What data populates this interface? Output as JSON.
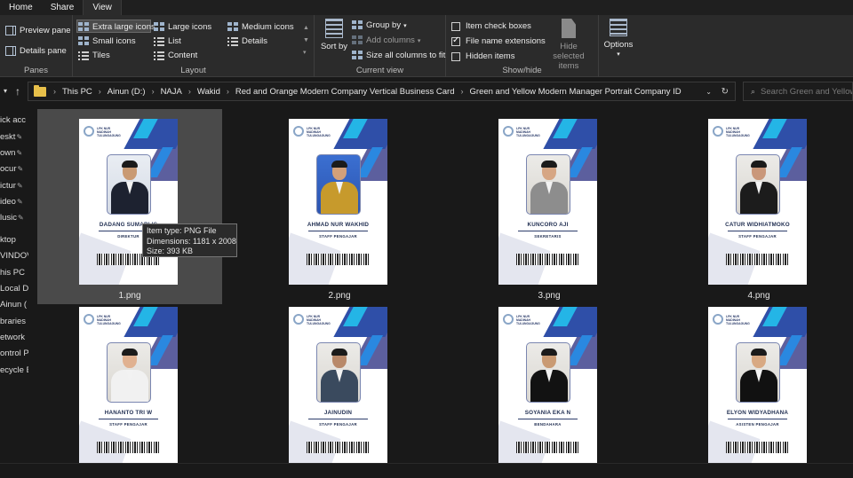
{
  "menu": {
    "tabs": [
      "Home",
      "Share",
      "View"
    ],
    "active": "View"
  },
  "ribbon": {
    "panes": {
      "preview": "Preview pane",
      "details": "Details pane",
      "label": "Panes"
    },
    "layout": {
      "items": [
        "Extra large icons",
        "Large icons",
        "Medium icons",
        "Small icons",
        "List",
        "Details",
        "Tiles",
        "Content"
      ],
      "selected": "Extra large icons",
      "label": "Layout"
    },
    "current_view": {
      "sort": "Sort by",
      "group": "Group by",
      "add_columns": "Add columns",
      "size_all": "Size all columns to fit",
      "label": "Current view"
    },
    "show_hide": {
      "item_check_boxes": "Item check boxes",
      "file_name_extensions": "File name extensions",
      "hidden_items": "Hidden items",
      "file_name_extensions_checked": true,
      "hide_selected": "Hide selected items",
      "label": "Show/hide"
    },
    "options": "Options"
  },
  "address": {
    "crumbs": [
      "This PC",
      "Ainun (D:)",
      "NAJA",
      "Wakid",
      "Red and Orange Modern Company Vertical Business Card",
      "Green and Yellow Modern Manager Portrait Company ID"
    ],
    "search_placeholder": "Search Green and Yellow Modern Manager Portrait Company ID"
  },
  "navpane": {
    "items": [
      "ick acc",
      "eskt",
      "own",
      "ocur",
      "ictur",
      "ideo",
      "lusic",
      "ktop",
      "VINDOV",
      "his PC",
      "Local D",
      "Ainun (",
      "braries",
      "etwork",
      "ontrol P",
      "ecycle E"
    ]
  },
  "files": [
    {
      "filename": "1.png",
      "name": "DADANG SUMARLIS",
      "role": "DIREKTUR"
    },
    {
      "filename": "2.png",
      "name": "AHMAD NUR WAKHID",
      "role": "STAFF PENGAJAR"
    },
    {
      "filename": "3.png",
      "name": "KUNCORO AJI",
      "role": "SEKRETARIS"
    },
    {
      "filename": "4.png",
      "name": "CATUR WIDHIATMOKO",
      "role": "STAFF PENGAJAR"
    },
    {
      "filename": "",
      "name": "HANANTO TRI W",
      "role": "STAFF PENGAJAR"
    },
    {
      "filename": "",
      "name": "JAINUDIN",
      "role": "STAFF PENGAJAR"
    },
    {
      "filename": "",
      "name": "SOYANIA EKA N",
      "role": "BENDAHARA"
    },
    {
      "filename": "",
      "name": "ELYON WIDYADHANA",
      "role": "ASISTEN PENGAJAR"
    }
  ],
  "card_logo_text": "LPK NUR MADINAH TULUNGAGUNG",
  "tooltip": {
    "type": "Item type: PNG File",
    "dimensions": "Dimensions: 1181 x 2008",
    "size": "Size: 393 KB"
  },
  "colors": {
    "card_blue": "#2f4fa8",
    "card_cyan": "#24b5e6",
    "card_purple": "#5c5f9e",
    "selection": "#4a4a4a",
    "folder": "#e8c04a"
  }
}
